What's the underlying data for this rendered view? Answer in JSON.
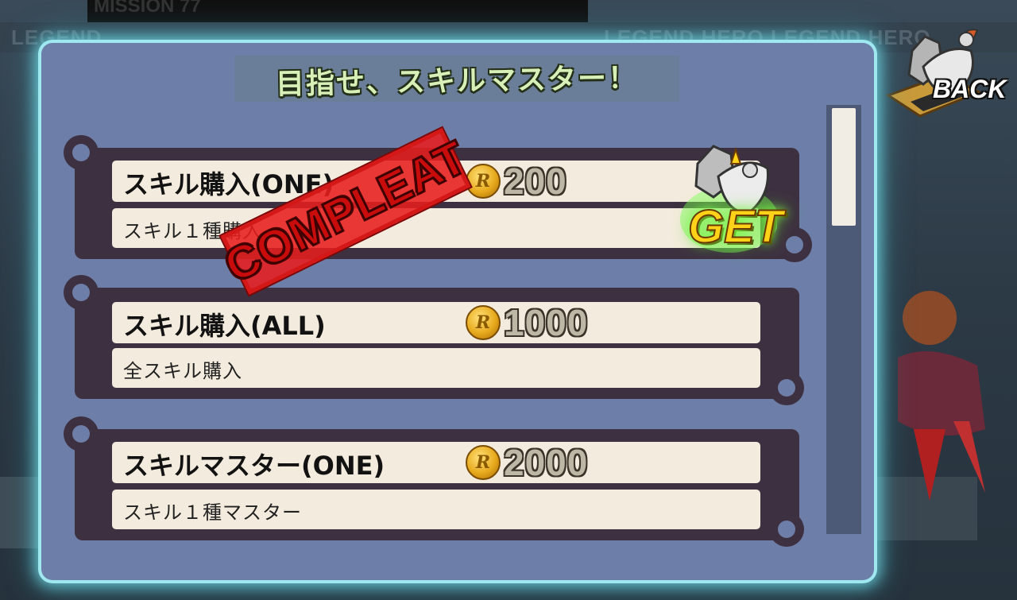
{
  "background": {
    "top_label": "MISSION 77",
    "bar_left": "LEGEND",
    "bar_right": "LEGEND HERO  LEGEND HERO"
  },
  "title": "目指せ、スキルマスター！",
  "back_label": "BACK",
  "get_label": "GET",
  "stamp_label": "COMPLEAT",
  "coin_glyph": "R",
  "colors": {
    "panel": "#6d7fa8",
    "glow": "#9fe8f0",
    "stamp": "#d41818",
    "get": "#ffd21a"
  },
  "missions": [
    {
      "title": "スキル購入(ONE)",
      "reward": "200",
      "description": "スキル１種購入",
      "completed": true
    },
    {
      "title": "スキル購入(ALL)",
      "reward": "1000",
      "description": "全スキル購入",
      "completed": false
    },
    {
      "title": "スキルマスター(ONE)",
      "reward": "2000",
      "description": "スキル１種マスター",
      "completed": false
    }
  ]
}
